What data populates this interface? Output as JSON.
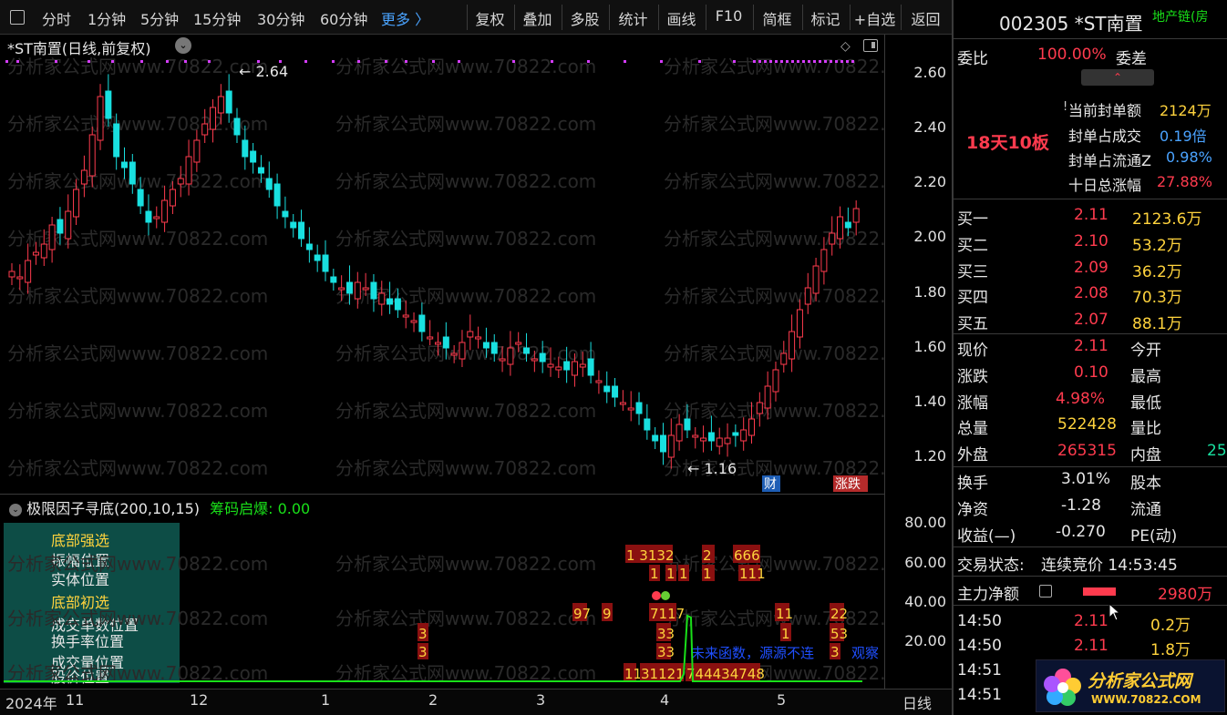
{
  "toolbar": {
    "periods": [
      "分时",
      "1分钟",
      "5分钟",
      "15分钟",
      "30分钟",
      "60分钟",
      "更多 〉"
    ],
    "buttons": [
      "复权",
      "叠加",
      "多股",
      "统计",
      "画线",
      "F10",
      "简框",
      "标记",
      "+自选",
      "返回"
    ]
  },
  "chart": {
    "title": "*ST南置(日线,前复权)",
    "high_label": "2.64",
    "low_label": "1.16",
    "watermark": "分析家公式网www.70822.com",
    "badges": {
      "cai": "财",
      "zhangdie": "涨跌"
    },
    "price_axis": [
      "2.60",
      "2.40",
      "2.20",
      "2.00",
      "1.80",
      "1.60",
      "1.40",
      "1.20"
    ]
  },
  "indicator": {
    "name": "极限因子寻底(200,10,15)",
    "chip_label": "筹码启爆:",
    "chip_value": "0.00",
    "labels": [
      "底部强选",
      "振幅位置",
      "实体位置",
      "底部初选",
      "成交单数位置",
      "换手率位置",
      "成交量位置",
      "股价位置"
    ],
    "axis": [
      "80.00",
      "60.00",
      "40.00",
      "20.00"
    ],
    "bars_row1": "1 3132",
    "bars_row2": "2",
    "bars_row3": "666",
    "blue_text": "未来函数，源源不连",
    "blue_text2": "观察"
  },
  "dates": {
    "labels": [
      "2024年",
      "11",
      "12",
      "1",
      "2",
      "3",
      "4",
      "5"
    ],
    "period": "日线"
  },
  "quote": {
    "code": "002305",
    "name": "*ST南置",
    "sector": "地产链(房",
    "weibi_label": "委比",
    "weibi": "100.00%",
    "weicha_label": "委差",
    "streak": "18天10板",
    "seal_items": [
      {
        "label": "当前封单额",
        "value": "2124万"
      },
      {
        "label": "封单占成交",
        "value": "0.19倍"
      },
      {
        "label": "封单占流通Z",
        "value": "0.98%"
      },
      {
        "label": "十日总涨幅",
        "value": "27.88%"
      }
    ],
    "bids": [
      {
        "label": "买一",
        "price": "2.11",
        "vol": "2123.6万"
      },
      {
        "label": "买二",
        "price": "2.10",
        "vol": "53.2万"
      },
      {
        "label": "买三",
        "price": "2.09",
        "vol": "36.2万"
      },
      {
        "label": "买四",
        "price": "2.08",
        "vol": "70.3万"
      },
      {
        "label": "买五",
        "price": "2.07",
        "vol": "88.1万"
      }
    ],
    "stats": [
      {
        "l": "现价",
        "v": "2.11",
        "l2": "今开"
      },
      {
        "l": "涨跌",
        "v": "0.10",
        "l2": "最高"
      },
      {
        "l": "涨幅",
        "v": "4.98%",
        "l2": "最低"
      },
      {
        "l": "总量",
        "v": "522428",
        "l2": "量比"
      },
      {
        "l": "外盘",
        "v": "265315",
        "l2": "内盘",
        "v2": "25"
      }
    ],
    "stats2": [
      {
        "l": "换手",
        "v": "3.01%",
        "l2": "股本"
      },
      {
        "l": "净资",
        "v": "-1.28",
        "l2": "流通"
      },
      {
        "l": "收益(—)",
        "v": "-0.270",
        "l2": "PE(动)"
      }
    ],
    "trade_status_label": "交易状态:",
    "trade_status": "连续竞价 14:53:45",
    "main_flow_label": "主力净额",
    "main_flow": "2980万",
    "ticks": [
      {
        "t": "14:50",
        "p": "2.11",
        "v": "0.2万"
      },
      {
        "t": "14:50",
        "p": "2.11",
        "v": "1.8万"
      },
      {
        "t": "14:51",
        "p": "",
        "v": ""
      },
      {
        "t": "14:51",
        "p": "",
        "v": ""
      }
    ]
  },
  "logo": {
    "cn": "分析家公式网",
    "url": "WWW.70822.COM"
  },
  "colors": {
    "up": "#ff3b4e",
    "down": "#19e0e0",
    "yellow": "#ffd33d",
    "green": "#19e019",
    "magenta": "#d63cff"
  }
}
